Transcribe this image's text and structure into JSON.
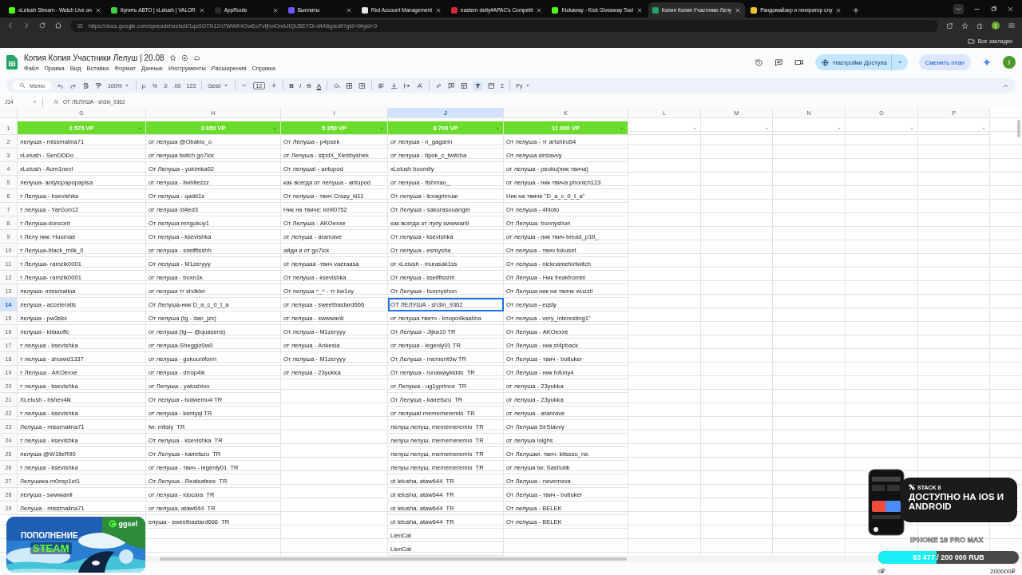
{
  "browser": {
    "tabs": [
      {
        "title": "xLelush Stream - Watch Live on",
        "color": "#53fc18",
        "selected": false
      },
      {
        "title": "Купить АВТО | xLelush | VALOR",
        "color": "#3ecf3e",
        "selected": false
      },
      {
        "title": "AppRoute",
        "color": "#2a2a2a",
        "selected": false
      },
      {
        "title": "Выплаты",
        "color": "#6d5cf0",
        "selected": false
      },
      {
        "title": "Riot Account Management",
        "color": "#e8e8e8",
        "selected": false
      },
      {
        "title": "eastern deity#APAC's Competit",
        "color": "#d2283c",
        "selected": false
      },
      {
        "title": "Kickaway - Kick Giveaway Tool",
        "color": "#53fc18",
        "selected": false
      },
      {
        "title": "Копия Копия Участники Лелу",
        "color": "#22a565",
        "selected": true
      },
      {
        "title": "Рандомайзер и генератор слу",
        "color": "#f2c12e",
        "selected": false
      }
    ],
    "url": "https://docs.google.com/spreadsheets/d/1qsSGTN12n7WWK4GwEoTvfjhviOnAJIQU5EYDi-d4A6g/edit?gid=0#gid=0",
    "profile_initial": "I",
    "bookmarks_label": "Все закладки"
  },
  "sheet": {
    "title": "Копия Копия Участники Лелуш | 20.08",
    "menu": [
      "Файл",
      "Правка",
      "Вид",
      "Вставка",
      "Формат",
      "Данные",
      "Инструменты",
      "Расширения",
      "Справка"
    ],
    "share_button": "Настройки Доступа",
    "plan_button": "Сменить план",
    "avatar": "I"
  },
  "toolbar": {
    "search": "Меню",
    "zoom": "100%",
    "number_formats": [
      "р.",
      "%",
      ".0",
      ".00",
      "123"
    ],
    "font": "Geist",
    "font_size": "12",
    "text_styles": [
      "B",
      "I",
      "S",
      "A"
    ],
    "sum": "Σ",
    "input_tools": "Ру"
  },
  "formula_bar": {
    "cell_ref": "J14",
    "function_label": "fx",
    "value": "ОТ ЛЕЛУША - sh3in_9362"
  },
  "grid": {
    "columns": [
      {
        "letter": "G",
        "selected": false
      },
      {
        "letter": "H",
        "selected": false
      },
      {
        "letter": "I",
        "selected": false
      },
      {
        "letter": "J",
        "selected": true
      },
      {
        "letter": "K",
        "selected": false
      },
      {
        "letter": "L",
        "selected": false
      },
      {
        "letter": "M",
        "selected": false
      },
      {
        "letter": "N",
        "selected": false
      },
      {
        "letter": "O",
        "selected": false
      },
      {
        "letter": "P",
        "selected": false
      }
    ],
    "header_row": {
      "number": "1",
      "cells": [
        "2 575 VP",
        "3 650 VP",
        "5 350 VP",
        "8 700 VP",
        "11 000 VP",
        null,
        null,
        null,
        null,
        null
      ]
    },
    "rows": [
      {
        "number": "2",
        "selected": false,
        "cells": [
          "лелуша - missmalina71",
          "от лелуша @Obakio_o",
          "От Лелуша - p4psek",
          "от лелуша - n_gagarin",
          "От лелуша - тг artshiro54"
        ]
      },
      {
        "number": "3",
        "selected": false,
        "cells": [
          "xLelush - SenDDDo",
          "от лелуша twitch go7ick",
          "от Лелуша - stpdX_Xlebbyshek",
          "от лелуша - tipok_c_twitcha",
          "От лелуша sirslavvy"
        ]
      },
      {
        "number": "4",
        "selected": false,
        "cells": [
          "xLelush - Aom1nevl",
          "От Лелуша - yukimka02",
          "От лелуша! - antupod",
          "xLelush boomlly",
          "от лелуша - peoku(ник твича)"
        ]
      },
      {
        "number": "5",
        "selected": false,
        "cells": [
          "лелуша- antylopapopapisa",
          "от лелуша - liwhitezzz",
          "как всегда от лелуша - antupod",
          "от лелуша - fishmao_",
          "от лелуша - ник твича phonich123"
        ]
      },
      {
        "number": "6",
        "selected": false,
        "cells": [
          "т Лелуша - ksevishka",
          "От лелуша - qadd1s",
          "От лелуша - твич Crazy_ki11",
          "От лелуша - lexagrimuar",
          "Ник на твиче \"D_a_c_0_t_a\""
        ]
      },
      {
        "number": "7",
        "selected": false,
        "cells": [
          "т лелуша - YarGon12",
          "от лелуша /d4ed3",
          "Ник на твиче: kirill0752",
          "От Лелуша - sakurasouangel",
          "От лелуша - 4htoto"
        ]
      },
      {
        "number": "8",
        "selected": false,
        "cells": [
          "т Лелуша-doncont",
          "От лелуша rengokuy1",
          "От Лелуша - AKOexxe",
          "как всегда от лупу swwwanli",
          "От Лелуша. bunnyshon"
        ]
      },
      {
        "number": "9",
        "selected": false,
        "cells": [
          "т Лелу ник: Huomae",
          "От лелуша - ksevishka",
          "от лелуша - aranrave",
          "От лелуша - ksevishka",
          "от лелуша - ник твич bread_p1tt_"
        ]
      },
      {
        "number": "10",
        "selected": false,
        "cells": [
          "т Лелуша-black_milk_0",
          "от лелуша - sselffisshh",
          "айди и от go7ick",
          "От лелуша - esmysha",
          "От лелуша - твич fokuset"
        ]
      },
      {
        "number": "11",
        "selected": false,
        "cells": [
          "т Лелуша- ramzik0001",
          "От лелуша - M1zeryyy",
          "от лелушаа -твич vaeraasa",
          "от xLelush - murasak1ss",
          "От лелуша - nicknamefortwitch"
        ]
      },
      {
        "number": "12",
        "selected": false,
        "cells": [
          "т Лелуша- ramzik0001",
          "от лелуша - boxn1k",
          "От лелуша - ksevishka",
          "От лелуша - sselffisshh",
          "От Лелуша - Ник freakfrombl"
        ]
      },
      {
        "number": "13",
        "selected": false,
        "cells": [
          "лелуша- missmalina",
          "от лелуша тг shdklei",
          "От лелуша ^_^ - тг kw1xy",
          "От Лелуша - bunnyshon",
          "От Лелуша ник на твиче wuzzil"
        ]
      },
      {
        "number": "14",
        "selected": true,
        "cells": [
          "лелуша - acceleratis",
          "От Лелуша-ник D_a_c_0_t_a",
          "от лелуша - sweetbastard666",
          "ОТ ЛЕЛУША - sh3in_9362",
          "От лелуша - eqsly"
        ]
      },
      {
        "number": "15",
        "selected": false,
        "cells": [
          "лелуша - pw3skx",
          "От лелуша (tg - dan_jzx)",
          "от лелуша - swwwanli",
          "от лелуша твитч - knopo4kaalina",
          "От лелуша - very_interesting1\""
        ]
      },
      {
        "number": "16",
        "selected": false,
        "cells": [
          "лелуша - kitaaoffc",
          "от лелуша (tg— @quasens)",
          "От лелуша - M1zeryyy",
          "От Лелуша - Jijka10 TR",
          "От Лелуша - AKOexxe"
        ]
      },
      {
        "number": "17",
        "selected": false,
        "cells": [
          "т лелуша - ksevishka",
          "от лелуша-Sheggiz0w0",
          "от лелуша - Ankesia",
          "от лелуша - legenly01 TR",
          "От Лелуша - ник st4pback"
        ]
      },
      {
        "number": "18",
        "selected": false,
        "cells": [
          "т лелуша - showid1337",
          "от лелуша - gokuuniform",
          "От лелуша - M1zeryyy",
          "От Лелуша - mement0w TR",
          "От Лелуша - твич - butluker"
        ]
      },
      {
        "number": "19",
        "selected": false,
        "cells": [
          "т Лелуша - AKOexxe",
          "от лелуша - drrop4ik",
          "от лелуша - 23yukka",
          "От лелуша - runawaykidds  TR",
          "От Лелуша - ник fufuny4"
        ]
      },
      {
        "number": "20",
        "selected": false,
        "cells": [
          "т лелуша - ksevishka",
          "от Лелуша - yatoshioo",
          null,
          "от Лелуша - ug1yprince  TR",
          "от лелуша - 23yukka"
        ]
      },
      {
        "number": "21",
        "selected": false,
        "cells": [
          "XLelush - hshev4ik",
          "От лелуша - tudwemu4 TR",
          null,
          "От Лелуша - kairetszu  TR",
          "от лелуша - 23yukka"
        ]
      },
      {
        "number": "22",
        "selected": false,
        "cells": [
          "т лелуша - ksevishka",
          "от лелуша - kentyqi TR",
          null,
          "от лелуша! mememeremio  TR",
          "от лелуша - aranrave"
        ]
      },
      {
        "number": "23",
        "selected": false,
        "cells": [
          "Лелуша - missmalina71",
          "tw: mitsiy  TR",
          null,
          "лелуш лелуш, mememeremio  TR",
          "От Лелуша SirSlavvy"
        ]
      },
      {
        "number": "24",
        "selected": false,
        "cells": [
          "т лелуша - ksevishka",
          "От лелуша - ksevishka  TR",
          null,
          "лелуш лелуш, mememeremio  TR",
          "от лелуша lolghs"
        ]
      },
      {
        "number": "25",
        "selected": false,
        "cells": [
          "лелуша @W1lleR90",
          "От Лелуша - kairetszu  TR",
          null,
          "лелуш лелуш, mememeremio  TR",
          "От Лелушки. твич: kitsssu_ne."
        ]
      },
      {
        "number": "26",
        "selected": false,
        "cells": [
          "т лелуша - ksevishka",
          "от лелуша - твич - legenly01  TR",
          null,
          "лелуш лелуш, mememeremio  TR",
          "от лелуша tw: Sashutik"
        ]
      },
      {
        "number": "27",
        "selected": false,
        "cells": [
          "Лелушика-m0nsp1et1",
          "От Лелуша - Realsafeee  TR",
          null,
          "ot lelusha, ataw644  TR",
          "От Лелуша - nevernxva"
        ]
      },
      {
        "number": "28",
        "selected": false,
        "cells": [
          "лелуша - swwwanli",
          "от лелуша - idocara  TR",
          null,
          "ot lelusha, ataw644  TR",
          "От Лелуша - твич - butluker"
        ]
      },
      {
        "number": "29",
        "selected": false,
        "cells": [
          "Лелуша - missmalina71",
          "от лелуша, ataw644  TR",
          null,
          "ot lelusha, ataw644  TR",
          "От лелуша - BELEK"
        ]
      },
      {
        "selected": false,
        "cells": [
          null,
          "елуша - sweetbastard666  TR",
          null,
          "ot lelusha, ataw644  TR",
          "От лелуша - BELEK"
        ]
      },
      {
        "selected": false,
        "cells": [
          null,
          null,
          null,
          "LlenCat",
          null
        ]
      },
      {
        "selected": false,
        "cells": [
          null,
          null,
          null,
          "LlenCat",
          null
        ]
      }
    ]
  },
  "promo_left": {
    "kind": "picture",
    "brand": "ggsel",
    "line1": "ПОПОЛНЕНИЕ",
    "line2": "STEAM"
  },
  "promo_right": {
    "brand": "STACK 8",
    "headline": "ДОСТУПНО НА IOS И ANDROID",
    "goal_title": "IPHONE 18 PRO MAX",
    "goal_amount": "83 477 / 200 000 RUB",
    "level": 0.417,
    "min_label": "0₽",
    "max_label": "200000₽"
  }
}
